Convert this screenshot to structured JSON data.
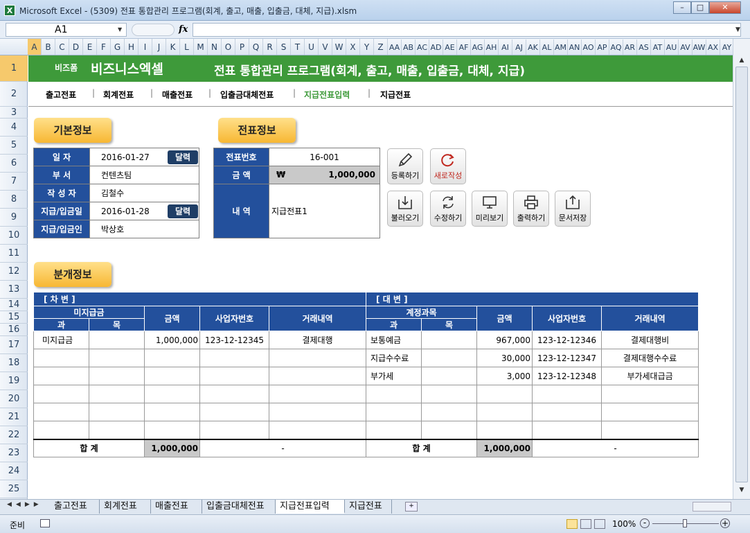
{
  "window": {
    "title": "Microsoft Excel - (5309) 전표 통합관리 프로그램(회계, 출고, 매출, 입출금, 대체, 지급).xlsm"
  },
  "formula_bar": {
    "name_box": "A1",
    "fx": "fx",
    "formula": ""
  },
  "columns": [
    "A",
    "B",
    "C",
    "D",
    "E",
    "F",
    "G",
    "H",
    "I",
    "J",
    "K",
    "L",
    "M",
    "N",
    "O",
    "P",
    "Q",
    "R",
    "S",
    "T",
    "U",
    "V",
    "W",
    "X",
    "Y",
    "Z",
    "AA",
    "AB",
    "AC",
    "AD",
    "AE",
    "AF",
    "AG",
    "AH",
    "AI",
    "AJ",
    "AK",
    "AL",
    "AM",
    "AN",
    "AO",
    "AP",
    "AQ",
    "AR",
    "AS",
    "AT",
    "AU",
    "AV",
    "AW",
    "AX",
    "AY"
  ],
  "rows": [
    "1",
    "2",
    "3",
    "4",
    "5",
    "6",
    "7",
    "8",
    "9",
    "10",
    "11",
    "12",
    "13",
    "14",
    "15",
    "16",
    "17",
    "18",
    "19",
    "20",
    "21",
    "22",
    "23",
    "24",
    "25"
  ],
  "header": {
    "brand_small": "비즈폼",
    "brand_big": "비즈니스엑셀",
    "program_title": "전표 통합관리 프로그램(회계, 출고, 매출, 입출금, 대체, 지급)"
  },
  "nav": [
    "출고전표",
    "회계전표",
    "매출전표",
    "입출금대체전표",
    "지급전표입력",
    "지급전표"
  ],
  "nav_active_color": "#3e9a3a",
  "sections": {
    "basic": "기본정보",
    "voucher": "전표정보",
    "distribution": "분개정보"
  },
  "basic_info": [
    {
      "label": "일    자",
      "value": "2016-01-27",
      "button": "달력"
    },
    {
      "label": "부    서",
      "value": "컨텐츠팀"
    },
    {
      "label": "작 성 자",
      "value": "김철수"
    },
    {
      "label": "지급/입금일",
      "value": "2016-01-28",
      "button": "달력"
    },
    {
      "label": "지급/입금인",
      "value": "박상호"
    }
  ],
  "voucher_info": {
    "no_label": "전표번호",
    "no_value": "16-001",
    "amount_label": "금    액",
    "currency": "₩",
    "amount_value": "1,000,000",
    "desc_label": "내    역",
    "desc_value": "지급전표1"
  },
  "actions": [
    "등록하기",
    "새로작성",
    "불러오기",
    "수정하기",
    "미리보기",
    "출력하기",
    "문서저장"
  ],
  "debit": {
    "title": "[ 차      변 ]",
    "account_header": "미지급금",
    "sub": [
      "과",
      "목"
    ],
    "cols": [
      "금액",
      "사업자번호",
      "거래내역"
    ],
    "rows": [
      {
        "gwa": "미지급금",
        "mok": "",
        "amount": "1,000,000",
        "biz": "123-12-12345",
        "desc": "결제대행"
      },
      {
        "gwa": "",
        "mok": "",
        "amount": "",
        "biz": "",
        "desc": ""
      },
      {
        "gwa": "",
        "mok": "",
        "amount": "",
        "biz": "",
        "desc": ""
      },
      {
        "gwa": "",
        "mok": "",
        "amount": "",
        "biz": "",
        "desc": ""
      },
      {
        "gwa": "",
        "mok": "",
        "amount": "",
        "biz": "",
        "desc": ""
      },
      {
        "gwa": "",
        "mok": "",
        "amount": "",
        "biz": "",
        "desc": ""
      }
    ],
    "total_label": "합    계",
    "total": "1,000,000",
    "total_rest": "-"
  },
  "credit": {
    "title": "[ 대      변 ]",
    "account_header": "계정과목",
    "sub": [
      "과",
      "목"
    ],
    "cols": [
      "금액",
      "사업자번호",
      "거래내역"
    ],
    "rows": [
      {
        "gwa": "보통예금",
        "mok": "",
        "amount": "967,000",
        "biz": "123-12-12346",
        "desc": "결제대행비"
      },
      {
        "gwa": "지급수수료",
        "mok": "",
        "amount": "30,000",
        "biz": "123-12-12347",
        "desc": "결제대행수수료"
      },
      {
        "gwa": "부가세",
        "mok": "",
        "amount": "3,000",
        "biz": "123-12-12348",
        "desc": "부가세대급금"
      },
      {
        "gwa": "",
        "mok": "",
        "amount": "",
        "biz": "",
        "desc": ""
      },
      {
        "gwa": "",
        "mok": "",
        "amount": "",
        "biz": "",
        "desc": ""
      },
      {
        "gwa": "",
        "mok": "",
        "amount": "",
        "biz": "",
        "desc": ""
      }
    ],
    "total_label": "합    계",
    "total": "1,000,000",
    "total_rest": "-"
  },
  "sheet_tabs": [
    "출고전표",
    "회계전표",
    "매출전표",
    "입출금대체전표",
    "지급전표입력",
    "지급전표"
  ],
  "active_tab": "지급전표입력",
  "status": {
    "ready": "준비",
    "zoom": "100%"
  }
}
